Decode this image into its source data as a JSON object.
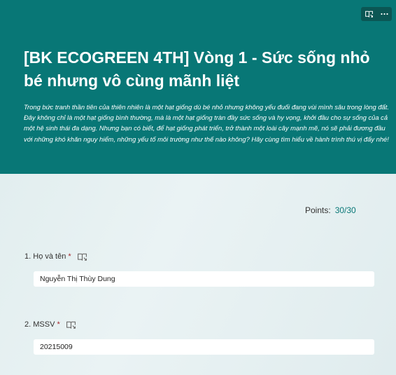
{
  "header": {
    "title": "[BK ECOGREEN 4TH] Vòng 1 - Sức sống nhỏ bé nhưng vô cùng mãnh liệt",
    "description": "Trong bức tranh thần tiên của thiên nhiên là một hạt giống dù bé nhỏ nhưng không yếu đuối đang vùi mình sâu trong lòng đất. Đây không chỉ là một hạt giống bình thường, mà là một hạt giống tràn đầy sức sống và hy vọng, khởi đầu cho sự sống của cả một hệ sinh thái đa dạng. Nhưng bạn có biết, để hạt giống phát triển, trở thành một loài cây mạnh mẽ, nó sẽ phải đương đầu với những khó khăn nguy hiểm, những yếu tố môi trường như thế nào không? Hãy cùng tìm hiểu về hành trình thú vị đấy nhé!",
    "tools": {
      "reader_icon": "immersive-reader-icon",
      "more_icon": "more-options-icon"
    }
  },
  "points": {
    "label": "Points:",
    "value": "30/30"
  },
  "questions": [
    {
      "number": "1.",
      "label": "Họ và tên",
      "required_mark": "*",
      "answer": "Nguyễn Thị Thùy Dung"
    },
    {
      "number": "2.",
      "label": "MSSV",
      "required_mark": "*",
      "answer": "20215009"
    }
  ],
  "colors": {
    "header_bg": "#087776",
    "accent": "#087776",
    "required": "#a4262c"
  }
}
